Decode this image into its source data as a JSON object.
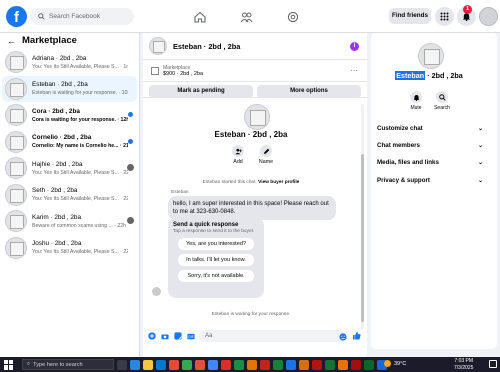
{
  "topbar": {
    "logo": "f",
    "search_placeholder": "Search Facebook",
    "find_friends": "Find friends",
    "notification_count": "1"
  },
  "marketplace": {
    "title": "Marketplace",
    "conversations": [
      {
        "name": "Adriana · 2bd , 2ba",
        "preview": "You: Yes Its Still Available, Please S... · 1m",
        "bold": false,
        "active": false,
        "indicator": "none"
      },
      {
        "name": "Esteban · 2bd , 2ba",
        "preview": "Esteban is waiting for your response. · 10h",
        "bold": false,
        "active": true,
        "indicator": "none"
      },
      {
        "name": "Cora · 2bd , 2ba",
        "preview": "Cora is waiting for your response. · 12h",
        "bold": true,
        "active": false,
        "indicator": "dot"
      },
      {
        "name": "Cornelio · 2bd , 2ba",
        "preview": "Cornelio: My name is Cornelio he... · 21h",
        "bold": true,
        "active": false,
        "indicator": "dot"
      },
      {
        "name": "Hajhie · 2bd , 2ba",
        "preview": "You: Yes Its Still Available, Please S... · 22h",
        "bold": false,
        "active": false,
        "indicator": "avatar"
      },
      {
        "name": "Seth · 2bd , 2ba",
        "preview": "You: Yes Its Still Available, Please S... · 22h",
        "bold": false,
        "active": false,
        "indicator": "none"
      },
      {
        "name": "Karim · 2bd , 2ba",
        "preview": "Beware of common scams using ... · 22h",
        "bold": false,
        "active": false,
        "indicator": "avatar"
      },
      {
        "name": "Joshu · 2bd , 2ba",
        "preview": "You: Yes Its Still Available, Please S... · 22h",
        "bold": false,
        "active": false,
        "indicator": "none"
      }
    ]
  },
  "chat": {
    "title": "Esteban · 2bd , 2ba",
    "listing_label": "Marketplace",
    "listing_price": "$900 · 2bd , 2ba",
    "mark_pending": "Mark as pending",
    "more_options": "More options",
    "profile_name": "Esteban · 2bd , 2ba",
    "add_label": "Add",
    "name_label": "Name",
    "started_text": "Esteban started this chat.",
    "view_profile": "View buyer profile",
    "sender": "Esteban",
    "message": "hello, I am super interested in this space! Please reach out to me at 323-630-0848.",
    "quick_title": "Send a quick response",
    "quick_sub": "Tap a response to send it to the buyer.",
    "quick_options": [
      "Yes, are you interested?",
      "In talks. I'll let you know.",
      "Sorry, it's not available."
    ],
    "waiting_text": "Esteban is waiting for your response.",
    "composer_placeholder": "Aa"
  },
  "details": {
    "name_highlight": "Esteban",
    "name_rest": " · 2bd , 2ba",
    "mute": "Mute",
    "search": "Search",
    "sections": [
      "Customize chat",
      "Chat members",
      "Media, files and links",
      "Privacy & support"
    ]
  },
  "taskbar": {
    "search_placeholder": "Type here to search",
    "temperature": "39°C",
    "time": "7:03 PM",
    "date": "7/3/2025"
  },
  "colors": {
    "brand": "#1877f2",
    "badge": "#e41e3f",
    "info": "#a033ff",
    "highlight": "#1a73e8"
  }
}
